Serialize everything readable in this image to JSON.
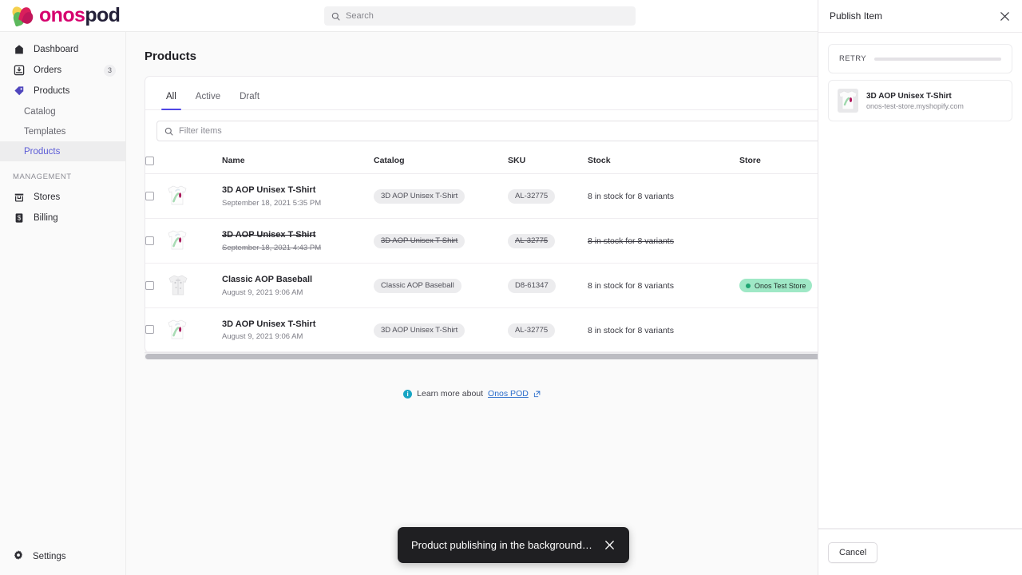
{
  "brand": {
    "name_primary": "onos",
    "name_secondary": "pod"
  },
  "topbar": {
    "search_placeholder": "Search",
    "search_value": "",
    "search_icon": "search-icon"
  },
  "sidebar": {
    "items": [
      {
        "label": "Dashboard",
        "icon": "home-icon",
        "badge": ""
      },
      {
        "label": "Orders",
        "icon": "inbox-download-icon",
        "badge": "3"
      },
      {
        "label": "Products",
        "icon": "tag-icon",
        "badge": ""
      }
    ],
    "sub_items": [
      {
        "label": "Catalog",
        "active": false
      },
      {
        "label": "Templates",
        "active": false
      },
      {
        "label": "Products",
        "active": true
      }
    ],
    "section_label": "MANAGEMENT",
    "management_items": [
      {
        "label": "Stores",
        "icon": "store-icon"
      },
      {
        "label": "Billing",
        "icon": "billing-icon"
      }
    ],
    "footer": {
      "label": "Settings",
      "icon": "gear-icon"
    }
  },
  "main": {
    "page_title": "Products",
    "tabs": [
      {
        "label": "All",
        "active": true
      },
      {
        "label": "Active",
        "active": false
      },
      {
        "label": "Draft",
        "active": false
      }
    ],
    "filter": {
      "placeholder": "Filter items",
      "value": "",
      "icon": "search-icon"
    },
    "columns": [
      "",
      "",
      "Name",
      "Catalog",
      "SKU",
      "Stock",
      "Store"
    ],
    "rows": [
      {
        "name": "3D AOP Unisex T-Shirt",
        "date": "September 18, 2021 5:35 PM",
        "catalog": "3D AOP Unisex T-Shirt",
        "sku": "AL-32775",
        "stock": "8 in stock for 8 variants",
        "store": "",
        "strike": false,
        "thumb": "tshirt"
      },
      {
        "name": "3D AOP Unisex T-Shirt",
        "date": "September 18, 2021 4:43 PM",
        "catalog": "3D AOP Unisex T-Shirt",
        "sku": "AL-32775",
        "stock": "8 in stock for 8 variants",
        "store": "",
        "strike": true,
        "thumb": "tshirt"
      },
      {
        "name": "Classic AOP Baseball",
        "date": "August 9, 2021 9:06 AM",
        "catalog": "Classic AOP Baseball",
        "sku": "D8-61347",
        "stock": "8 in stock for 8 variants",
        "store": "Onos Test Store",
        "strike": false,
        "thumb": "baseball"
      },
      {
        "name": "3D AOP Unisex T-Shirt",
        "date": "August 9, 2021 9:06 AM",
        "catalog": "3D AOP Unisex T-Shirt",
        "sku": "AL-32775",
        "stock": "8 in stock for 8 variants",
        "store": "",
        "strike": false,
        "thumb": "tshirt"
      }
    ],
    "learn_more": {
      "prefix": "Learn more about",
      "link": "Onos POD",
      "icon": "info-icon",
      "external_icon": "external-link-icon"
    }
  },
  "toast": {
    "message": "Product publishing in the background…",
    "close_icon": "close-icon"
  },
  "panel": {
    "title": "Publish Item",
    "close_icon": "close-icon",
    "retry_label": "RETRY",
    "progress_percent": 0,
    "item": {
      "name": "3D AOP Unisex T-Shirt",
      "store_domain": "onos-test-store.myshopify.com"
    },
    "cancel_label": "Cancel"
  },
  "colors": {
    "accent": "#4f46e5",
    "brand_pink": "#d6006e",
    "brand_navy": "#232038",
    "link": "#2c6ecb",
    "store_badge_bg": "#9fe8c6",
    "store_badge_dot": "#1fa572",
    "toast_bg": "#1f1f22"
  }
}
